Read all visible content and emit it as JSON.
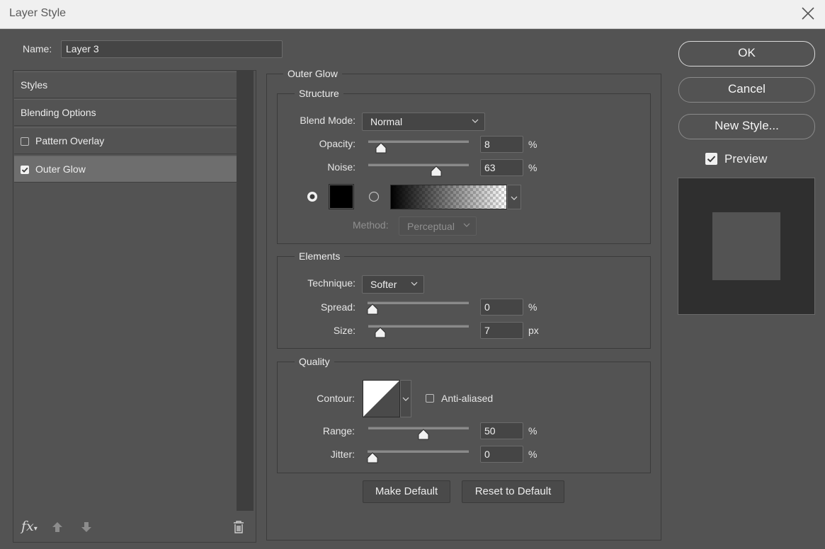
{
  "window": {
    "title": "Layer Style"
  },
  "name_field": {
    "label": "Name:",
    "value": "Layer 3"
  },
  "left_panel": {
    "items": [
      {
        "label": "Styles"
      },
      {
        "label": "Blending Options"
      },
      {
        "label": "Pattern Overlay",
        "checked": false
      },
      {
        "label": "Outer Glow",
        "checked": true,
        "selected": true
      }
    ],
    "fx_label": "fx"
  },
  "outer_glow": {
    "title": "Outer Glow",
    "structure": {
      "title": "Structure",
      "blend_mode_label": "Blend Mode:",
      "blend_mode_value": "Normal",
      "opacity_label": "Opacity:",
      "opacity_value": "8",
      "opacity_unit": "%",
      "opacity_fraction": 0.08,
      "noise_label": "Noise:",
      "noise_value": "63",
      "noise_unit": "%",
      "noise_fraction": 0.63,
      "glow_color": "#000000",
      "solid_color_selected": true,
      "method_label": "Method:",
      "method_value": "Perceptual"
    },
    "elements": {
      "title": "Elements",
      "technique_label": "Technique:",
      "technique_value": "Softer",
      "spread_label": "Spread:",
      "spread_value": "0",
      "spread_unit": "%",
      "spread_fraction": 0.0,
      "size_label": "Size:",
      "size_value": "7",
      "size_unit": "px",
      "size_fraction": 0.07
    },
    "quality": {
      "title": "Quality",
      "contour_label": "Contour:",
      "anti_aliased_label": "Anti-aliased",
      "anti_aliased_checked": false,
      "range_label": "Range:",
      "range_value": "50",
      "range_unit": "%",
      "range_fraction": 0.5,
      "jitter_label": "Jitter:",
      "jitter_value": "0",
      "jitter_unit": "%",
      "jitter_fraction": 0.0
    },
    "make_default_label": "Make Default",
    "reset_default_label": "Reset to Default"
  },
  "right_panel": {
    "ok_label": "OK",
    "cancel_label": "Cancel",
    "new_style_label": "New Style...",
    "preview_label": "Preview",
    "preview_checked": true
  },
  "colors": {
    "dialog_bg": "#535353",
    "titlebar_bg": "#f0f0f0",
    "selected_item": "#6e6e6e",
    "preview_bg": "#2f2f2f",
    "preview_square": "#535353"
  }
}
